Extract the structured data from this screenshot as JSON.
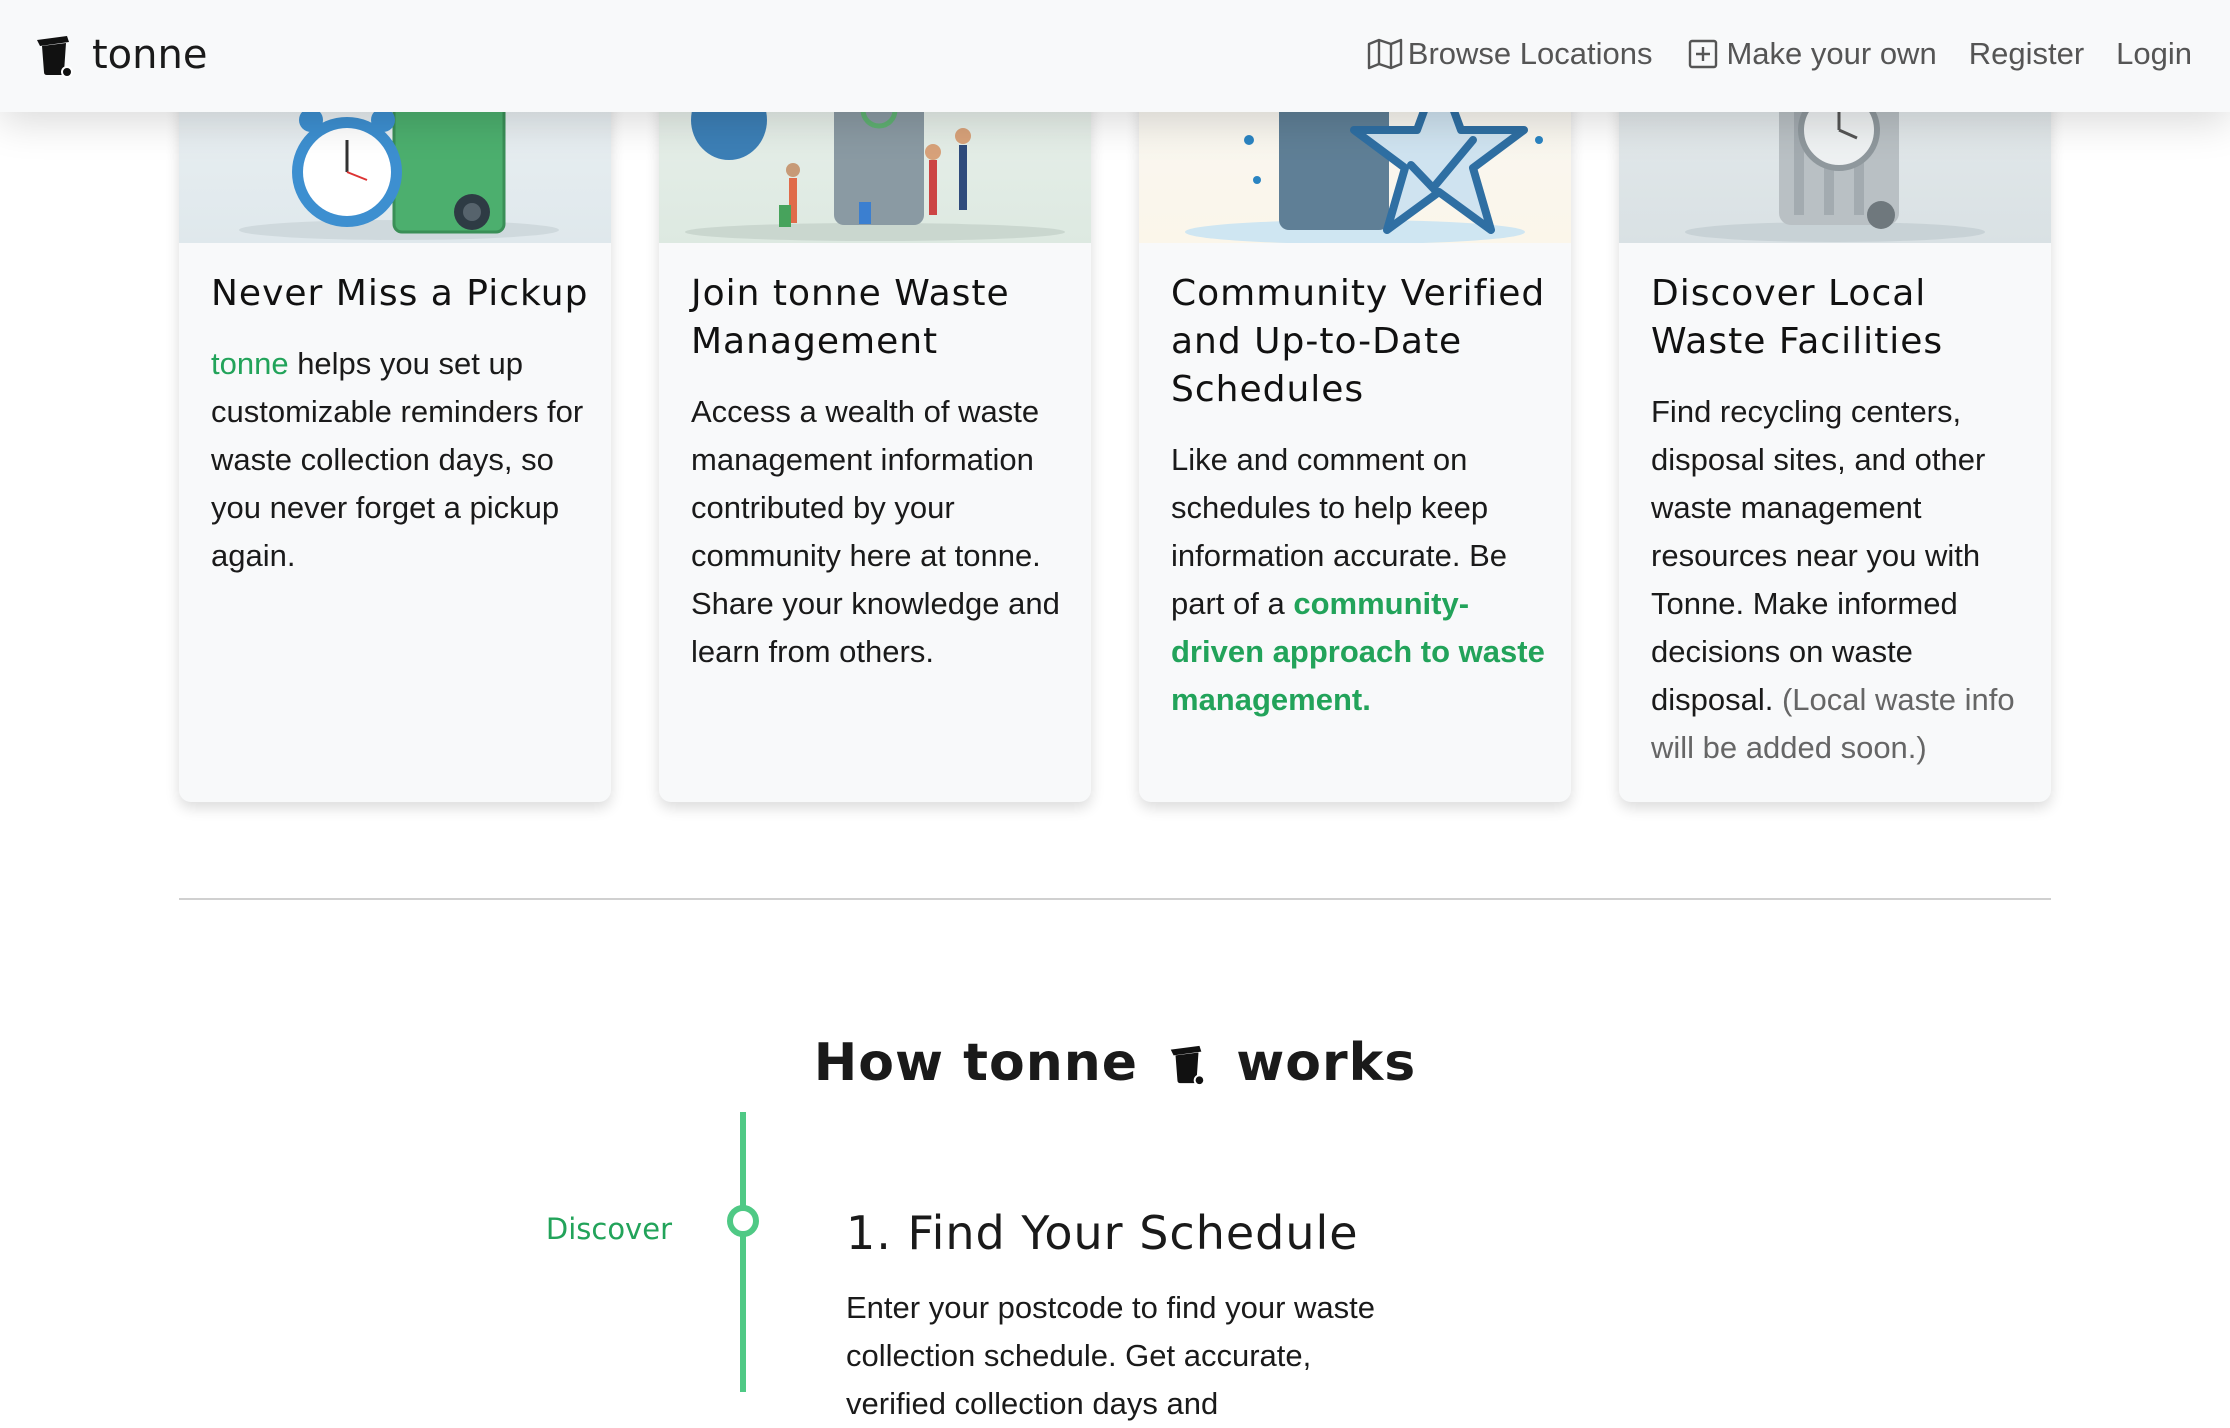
{
  "navbar": {
    "brand": "tonne",
    "links": [
      {
        "label": "Browse Locations",
        "icon": "map-icon"
      },
      {
        "label": "Make your own",
        "icon": "plus-square-icon"
      },
      {
        "label": "Register"
      },
      {
        "label": "Login"
      }
    ]
  },
  "cards": [
    {
      "title": "Never Miss a Pickup",
      "text_highlight": "tonne",
      "text": " helps you set up customizable reminders for waste collection days, so you never forget a pickup again.",
      "image": "alarm-clock-and-bin-illustration"
    },
    {
      "title": "Join tonne Waste Management",
      "text": "Access a wealth of waste management information contributed by your community here at tonne. Share your knowledge and learn from others.",
      "image": "community-around-bin-illustration"
    },
    {
      "title": "Community Verified and Up-to-Date Schedules",
      "text": "Like and comment on schedules to help keep information accurate. Be part of a ",
      "text_highlight": "community-driven approach to waste management.",
      "image": "bin-with-star-check-illustration"
    },
    {
      "title": "Discover Local Waste Facilities",
      "text": "Find recycling centers, disposal sites, and other waste management resources near you with Tonne. Make informed decisions on waste disposal.",
      "text_muted": " (Local waste info will be added soon.)",
      "image": "bin-with-clock-illustration"
    }
  ],
  "how_it_works": {
    "title_before": "How tonne",
    "title_after": "works",
    "steps": [
      {
        "tag": "Discover",
        "title": "1. Find Your Schedule",
        "text": "Enter your postcode to find your waste collection schedule. Get accurate, verified collection days and"
      }
    ]
  },
  "colors": {
    "accent_green": "#22a35a",
    "timeline_green": "#4fc985",
    "navbar_bg": "#f8f9fa",
    "card_bg": "#f8f9fa"
  }
}
